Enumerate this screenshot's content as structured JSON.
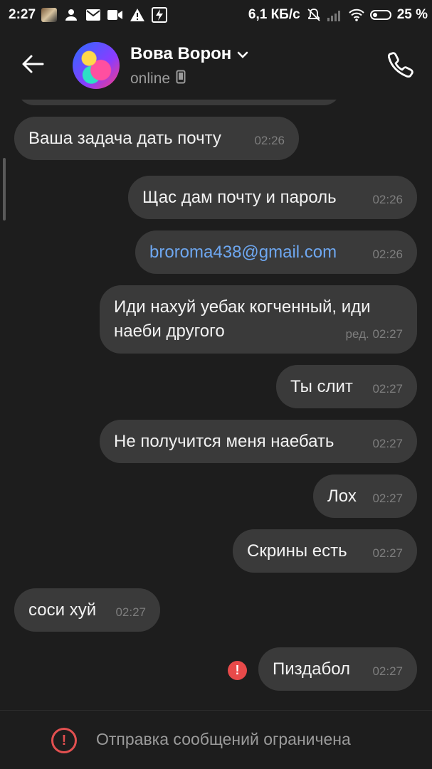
{
  "status_bar": {
    "time": "2:27",
    "network_speed": "6,1 КБ/с",
    "battery": "25 %",
    "left_icons": [
      "photo-thumbnail-icon",
      "person-icon",
      "mail-icon",
      "video-icon",
      "warning-icon",
      "flash-icon"
    ],
    "right_icons": [
      "mute-bell-icon",
      "signal-icon",
      "wifi-icon",
      "battery-icon"
    ]
  },
  "header": {
    "name": "Вова Ворон",
    "status": "online"
  },
  "messages": [
    {
      "side": "in",
      "text": "Ваша задача дать почту",
      "time": "02:26"
    },
    {
      "side": "out",
      "text": "Щас дам почту и пароль",
      "time": "02:26"
    },
    {
      "side": "out",
      "text": "broroma438@gmail.com",
      "time": "02:26",
      "is_link": true
    },
    {
      "side": "out",
      "text": "Иди нахуй уебак когченный, иди наеби другого",
      "time": "ред. 02:27"
    },
    {
      "side": "out",
      "text": "Ты слит",
      "time": "02:27"
    },
    {
      "side": "out",
      "text": "Не получится меня наебать",
      "time": "02:27"
    },
    {
      "side": "out",
      "text": "Лох",
      "time": "02:27"
    },
    {
      "side": "out",
      "text": "Скрины есть",
      "time": "02:27"
    },
    {
      "side": "in",
      "text": "соси хуй",
      "time": "02:27"
    },
    {
      "side": "out",
      "text": "Пиздабол",
      "time": "02:27",
      "failed": true
    }
  ],
  "bottom_bar": {
    "text": "Отправка сообщений ограничена"
  },
  "colors": {
    "background": "#1d1d1d",
    "bubble": "#3a3a3a",
    "link": "#6ea7f0",
    "error": "#e84a4a"
  }
}
